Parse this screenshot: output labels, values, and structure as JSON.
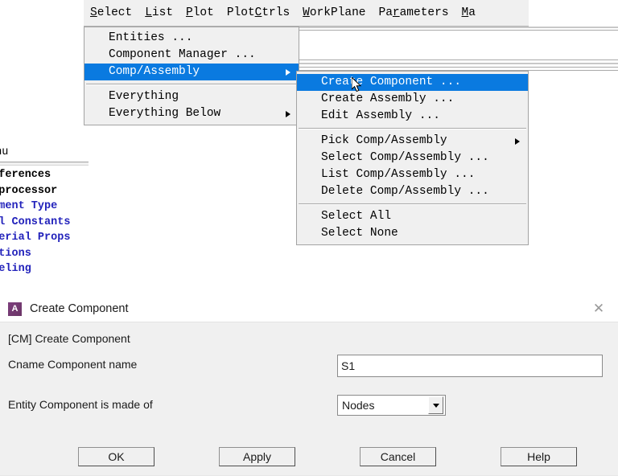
{
  "menu_bar": {
    "items": [
      {
        "pre": "",
        "accel": "S",
        "post": "elect"
      },
      {
        "pre": "",
        "accel": "L",
        "post": "ist"
      },
      {
        "pre": "",
        "accel": "P",
        "post": "lot"
      },
      {
        "pre": "Plot",
        "accel": "C",
        "post": "trls"
      },
      {
        "pre": "",
        "accel": "W",
        "post": "orkPlane"
      },
      {
        "pre": "Pa",
        "accel": "r",
        "post": "ameters"
      },
      {
        "pre": "",
        "accel": "M",
        "post": "a"
      }
    ]
  },
  "select_menu": {
    "name": "Select",
    "items": [
      {
        "label": "Entities ...",
        "submenu": false,
        "selected": false
      },
      {
        "label": "Component Manager ...",
        "submenu": false,
        "selected": false
      },
      {
        "label": "Comp/Assembly",
        "submenu": true,
        "selected": true
      },
      {
        "separator": true
      },
      {
        "label": "Everything",
        "submenu": false,
        "selected": false
      },
      {
        "label": "Everything Below",
        "submenu": true,
        "selected": false
      }
    ]
  },
  "comp_assembly_menu": {
    "name": "Comp/Assembly",
    "items": [
      {
        "label": "Create Component ...",
        "submenu": false,
        "selected": true
      },
      {
        "label": "Create Assembly ...",
        "submenu": false,
        "selected": false
      },
      {
        "label": "Edit Assembly ...",
        "submenu": false,
        "selected": false
      },
      {
        "separator": true
      },
      {
        "label": "Pick Comp/Assembly",
        "submenu": true,
        "selected": false
      },
      {
        "label": "Select Comp/Assembly ...",
        "submenu": false,
        "selected": false
      },
      {
        "label": "List Comp/Assembly ...",
        "submenu": false,
        "selected": false
      },
      {
        "label": "Delete Comp/Assembly ...",
        "submenu": false,
        "selected": false
      },
      {
        "separator": true
      },
      {
        "label": "Select All",
        "submenu": false,
        "selected": false
      },
      {
        "label": "Select None",
        "submenu": false,
        "selected": false
      }
    ]
  },
  "sidebar": {
    "header": "Menu",
    "items": [
      {
        "label": "Preferences",
        "color": "black"
      },
      {
        "label": "Preprocessor",
        "color": "black"
      },
      {
        "label": "Element Type",
        "color": "blue"
      },
      {
        "label": "Real Constants",
        "color": "blue"
      },
      {
        "label": "Material Props",
        "color": "blue"
      },
      {
        "label": "Sections",
        "color": "blue"
      },
      {
        "label": "Modeling",
        "color": "blue"
      }
    ]
  },
  "dialog": {
    "icon_letter": "A",
    "title": "Create Component",
    "close_glyph": "✕",
    "command_label": "[CM]  Create Component",
    "cname_label": "Cname   Component name",
    "cname_value": "S1",
    "cname_placeholder": "",
    "entity_label": "Entity  Component is made of",
    "entity_value": "Nodes",
    "buttons": {
      "ok": "OK",
      "apply": "Apply",
      "cancel": "Cancel",
      "help": "Help"
    }
  },
  "colors": {
    "menu_highlight": "#0a7ae0",
    "menu_bg": "#f0f0f0",
    "dialog_bg": "#f0f0f0",
    "tree_blue": "#2222bb",
    "ansys_purple": "#7d3f7d"
  }
}
